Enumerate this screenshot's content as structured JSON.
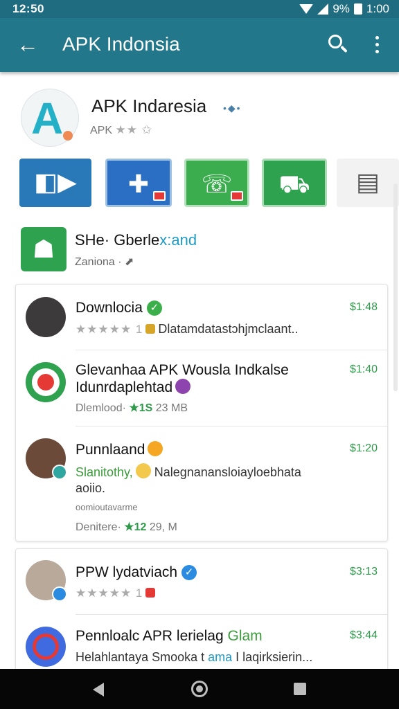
{
  "status_bar": {
    "time": "12:50",
    "battery": "9%",
    "time_right": "1:00"
  },
  "app_bar": {
    "title": "APK Indonsia",
    "icons": [
      "back-arrow-icon",
      "search-icon",
      "more-vert-icon"
    ]
  },
  "app_header": {
    "name": "APK Indaresia",
    "badge": "•◆•",
    "sub_text": "APK",
    "stars": "★★ ✩"
  },
  "tiles": [
    {
      "glyph": "◧▶"
    },
    {
      "glyph": "✚"
    },
    {
      "glyph": "☏"
    },
    {
      "glyph": "⛟"
    },
    {
      "glyph": "▤"
    }
  ],
  "section": {
    "title_a": "SHe· Gberle",
    "title_b": "x:and",
    "sub": "Zaniona ·",
    "robot": "☗"
  },
  "list_items": [
    {
      "title": "Downlocia",
      "price": "$1:48",
      "stars": "★★★★★ 1",
      "line": "Dlatamdatastɔhjmclaant..",
      "check": "✓"
    },
    {
      "title": "Glevanhaa APK Wousla Indkalse",
      "title2": "Idunrdaplehtad",
      "price": "$1:40",
      "meta_a": "Dlemlood·",
      "meta_rating": "★1S",
      "meta_size": "23 MB"
    },
    {
      "title": "Punnlaand",
      "price": "$1:20",
      "line_green": "Slanitothy,",
      "line_rest": "Nalegnanansloiayloebhata",
      "line2": "aoiio.",
      "small": "oomioutavarme",
      "meta_a": "Denitere·",
      "meta_rating": "★12",
      "meta_size": "29, M"
    },
    {
      "title": "PPW lydatviach",
      "price": "$3:13",
      "stars": "★★★★★ 1",
      "check": "✓"
    },
    {
      "title_a": "Pennloalc APR lerielag",
      "title_b": "Glam",
      "price": "$3:44",
      "line_a": "Helahlantaya Smooka t",
      "line_b": "ama",
      "line_c": "I laqirksierin..."
    }
  ],
  "nav_bar": {
    "icons": [
      "nav-back-icon",
      "nav-home-icon",
      "nav-recents-icon"
    ]
  },
  "colors": {
    "app_bar": "#22788a",
    "status_bar": "#1f6c80",
    "accent_green": "#2e9a4a",
    "price_green": "#2e9a4a"
  }
}
